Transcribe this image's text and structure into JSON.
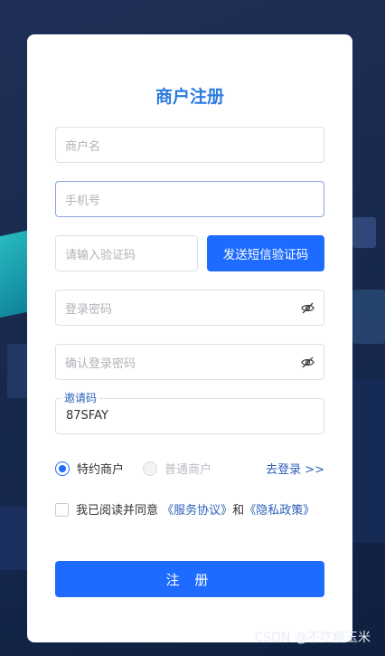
{
  "form": {
    "title": "商户注册",
    "merchant_name_placeholder": "商户名",
    "phone_placeholder": "手机号",
    "code_placeholder": "请输入验证码",
    "send_code_button": "发送短信验证码",
    "password_placeholder": "登录密码",
    "confirm_password_placeholder": "确认登录密码",
    "invite_label": "邀请码",
    "invite_value": "87SFAY",
    "merchant_type": {
      "option1": "特约商户",
      "option2": "普通商户",
      "selected": "特约商户"
    },
    "login_link": "去登录 >>",
    "agree_text_1": "我已阅读并同意",
    "service_agreement": "《服务协议》",
    "and": "和",
    "privacy_policy": "《隐私政策》",
    "submit_button": "注 册"
  },
  "watermark": "CSDN @不吃糯玉米",
  "colors": {
    "primary": "#1e6bff",
    "title": "#2b7be0",
    "link": "#2b5fb8"
  },
  "icons": {
    "password_toggle": "eye-off-icon"
  }
}
